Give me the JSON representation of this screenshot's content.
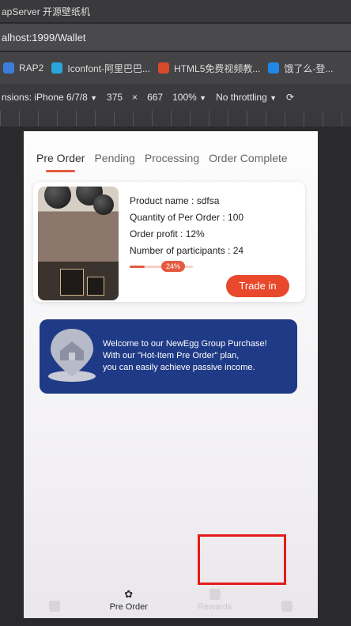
{
  "browser": {
    "title": "apServer 开源壁纸机",
    "url": "alhost:1999/Wallet",
    "bookmarks": [
      {
        "label": "RAP2",
        "color": "#3b7ddd"
      },
      {
        "label": "Iconfont-阿里巴巴...",
        "color": "#2aa7d8"
      },
      {
        "label": "HTML5免费视频教...",
        "color": "#d84a2a"
      },
      {
        "label": "饿了么-登...",
        "color": "#1e88e5"
      }
    ],
    "devtools": {
      "device": "nsions: iPhone 6/7/8",
      "width": "375",
      "times": "×",
      "height": "667",
      "zoom": "100%",
      "throttle": "No throttling"
    }
  },
  "app": {
    "tabs": [
      "Pre Order",
      "Pending",
      "Processing",
      "Order Complete"
    ],
    "active_tab": 0,
    "product": {
      "name_line": "Product name : sdfsa",
      "quantity_line": "Quantity of Per Order : 100",
      "profit_line": "Order profit : 12%",
      "participants_line": "Number of participants : 24",
      "progress_label": "24%",
      "progress_fraction": 0.24,
      "trade_button": "Trade in"
    },
    "banner": {
      "line1": "Welcome to our NewEgg Group Purchase!",
      "line2": "With our \"Hot-Item Pre Order\" plan,",
      "line3": "you can easily achieve passive income."
    },
    "bottom_nav": {
      "active_label": "Pre Order",
      "rewards_label": "Rewards"
    },
    "colors": {
      "accent": "#e8482b",
      "banner": "#1f3a86"
    }
  }
}
